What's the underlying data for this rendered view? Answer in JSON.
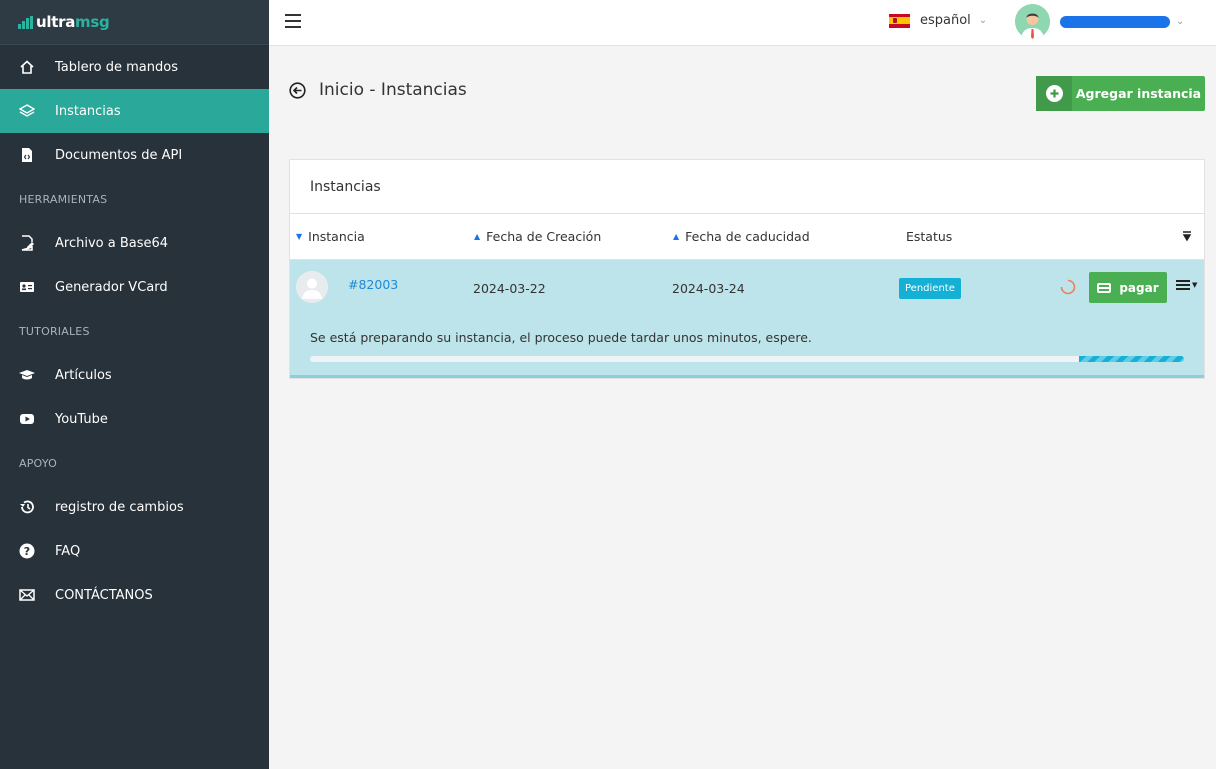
{
  "brand": {
    "name_part1": "ultra",
    "name_part2": "msg"
  },
  "sidebar": {
    "items": [
      {
        "label": "Tablero de mandos",
        "icon": "home-icon"
      },
      {
        "label": "Instancias",
        "icon": "layers-icon",
        "active": true
      },
      {
        "label": "Documentos de API",
        "icon": "code-file-icon"
      }
    ],
    "sections": [
      {
        "title": "HERRAMIENTAS",
        "items": [
          {
            "label": "Archivo a Base64",
            "icon": "file-edit-icon"
          },
          {
            "label": "Generador VCard",
            "icon": "id-card-icon"
          }
        ]
      },
      {
        "title": "TUTORIALES",
        "items": [
          {
            "label": "Artículos",
            "icon": "graduation-cap-icon"
          },
          {
            "label": "YouTube",
            "icon": "youtube-icon"
          }
        ]
      },
      {
        "title": "APOYO",
        "items": [
          {
            "label": "registro de cambios",
            "icon": "history-icon"
          },
          {
            "label": "FAQ",
            "icon": "question-icon"
          },
          {
            "label": "CONTÁCTANOS",
            "icon": "mail-icon"
          }
        ]
      }
    ]
  },
  "topbar": {
    "language": "español",
    "flag_icon": "spain-flag-icon"
  },
  "header": {
    "title": "Inicio - Instancias",
    "add_button": "Agregar instancia"
  },
  "panel": {
    "title": "Instancias",
    "columns": [
      "Instancia",
      "Fecha de Creación",
      "Fecha de caducidad",
      "Estatus"
    ],
    "rows": [
      {
        "id": "#82003",
        "created": "2024-03-22",
        "expires": "2024-03-24",
        "status": "Pendiente",
        "pay_label": "pagar",
        "message": "Se está preparando su instancia, el proceso puede tardar unos minutos, espere.",
        "progress": 0.12
      }
    ]
  },
  "colors": {
    "accent": "#2aa89a",
    "sidebar": "#28323a",
    "green_button": "#4aaf52",
    "status": "#14b0d6",
    "row_highlight": "#bde4ea"
  }
}
